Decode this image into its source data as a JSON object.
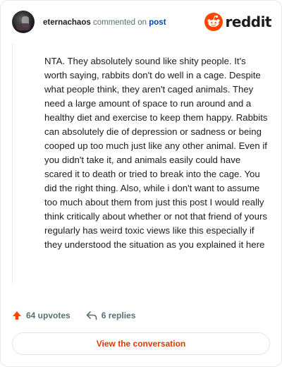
{
  "header": {
    "username": "eternachaos",
    "commented_on": "commented on",
    "post_link": "post",
    "logo_text": "reddit"
  },
  "comment": {
    "text": "NTA. They absolutely sound like shity people. It's worth saying, rabbits don't do well in a cage. Despite what people think, they aren't caged animals. They need a large amount of space to run around and a healthy diet and exercise to keep them happy. Rabbits can absolutely die of depression or sadness or being cooped up too much just like any other animal. Even if you didn't take it, and animals easily could have scared it to death or tried to break into the cage. You did the right thing. Also, while i don't want to assume too much about them from just this post I would really think critically about whether or not that friend of yours regularly has weird toxic views like this especially if they understood the situation as you explained it here"
  },
  "footer": {
    "upvotes": "64 upvotes",
    "replies": "6 replies",
    "view_button": "View the conversation"
  },
  "colors": {
    "accent": "#ff4500",
    "button_text": "#d93a00",
    "link": "#0045ac"
  },
  "icons": [
    "avatar",
    "reddit-logo-icon",
    "upvote-arrow-icon",
    "reply-icon"
  ]
}
